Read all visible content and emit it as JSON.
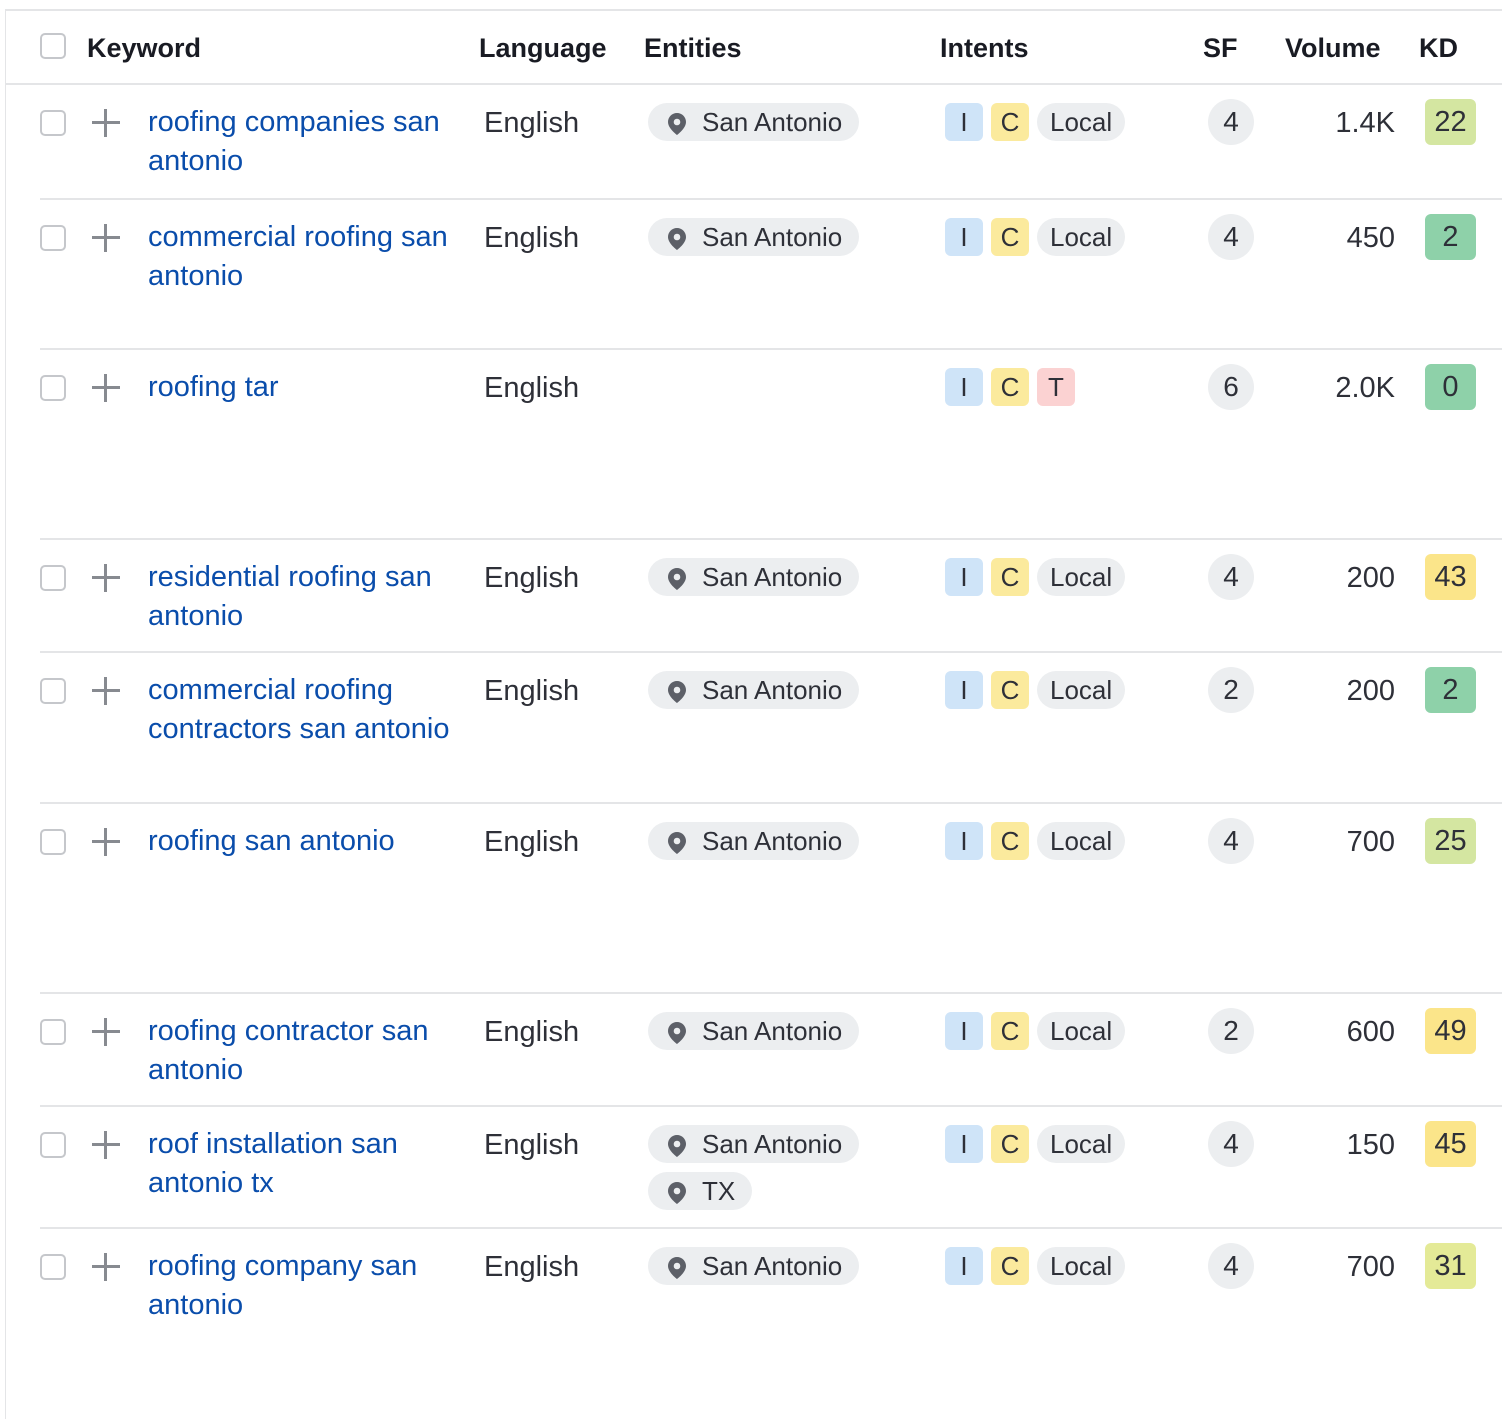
{
  "header": {
    "keyword": "Keyword",
    "language": "Language",
    "entities": "Entities",
    "intents": "Intents",
    "sf": "SF",
    "volume": "Volume",
    "kd": "KD"
  },
  "colors": {
    "keyword_link": "#0a4dab",
    "intent_i": "#cfe4f8",
    "intent_c": "#fbea9d",
    "intent_t": "#fbd2d2",
    "kd_very_easy": "#8ed1a9",
    "kd_easy": "#d4e6a1",
    "kd_possible": "#fbe58a",
    "kd_mid": "#e4ea97"
  },
  "rows": [
    {
      "keyword": "roofing companies san antonio",
      "language": "English",
      "entities": [
        "San Antonio"
      ],
      "intents": [
        "I",
        "C",
        "Local"
      ],
      "sf": "4",
      "volume": "1.4K",
      "kd": "22",
      "kd_color": "#d4e6a1"
    },
    {
      "keyword": "commercial roofing san antonio",
      "language": "English",
      "entities": [
        "San Antonio"
      ],
      "intents": [
        "I",
        "C",
        "Local"
      ],
      "sf": "4",
      "volume": "450",
      "kd": "2",
      "kd_color": "#8ed1a9"
    },
    {
      "keyword": "roofing tar",
      "language": "English",
      "entities": [],
      "intents": [
        "I",
        "C",
        "T"
      ],
      "sf": "6",
      "volume": "2.0K",
      "kd": "0",
      "kd_color": "#8ed1a9"
    },
    {
      "keyword": "residential roofing san antonio",
      "language": "English",
      "entities": [
        "San Antonio"
      ],
      "intents": [
        "I",
        "C",
        "Local"
      ],
      "sf": "4",
      "volume": "200",
      "kd": "43",
      "kd_color": "#fbe58a"
    },
    {
      "keyword": "commercial roofing contractors san antonio",
      "language": "English",
      "entities": [
        "San Antonio"
      ],
      "intents": [
        "I",
        "C",
        "Local"
      ],
      "sf": "2",
      "volume": "200",
      "kd": "2",
      "kd_color": "#8ed1a9"
    },
    {
      "keyword": "roofing san antonio",
      "language": "English",
      "entities": [
        "San Antonio"
      ],
      "intents": [
        "I",
        "C",
        "Local"
      ],
      "sf": "4",
      "volume": "700",
      "kd": "25",
      "kd_color": "#d4e6a1"
    },
    {
      "keyword": "roofing contractor san antonio",
      "language": "English",
      "entities": [
        "San Antonio"
      ],
      "intents": [
        "I",
        "C",
        "Local"
      ],
      "sf": "2",
      "volume": "600",
      "kd": "49",
      "kd_color": "#fbe58a"
    },
    {
      "keyword": "roof installation san antonio tx",
      "language": "English",
      "entities": [
        "San Antonio",
        "TX"
      ],
      "intents": [
        "I",
        "C",
        "Local"
      ],
      "sf": "4",
      "volume": "150",
      "kd": "45",
      "kd_color": "#fbe58a"
    },
    {
      "keyword": "roofing company san antonio",
      "language": "English",
      "entities": [
        "San Antonio"
      ],
      "intents": [
        "I",
        "C",
        "Local"
      ],
      "sf": "4",
      "volume": "700",
      "kd": "31",
      "kd_color": "#e4ea97"
    }
  ]
}
